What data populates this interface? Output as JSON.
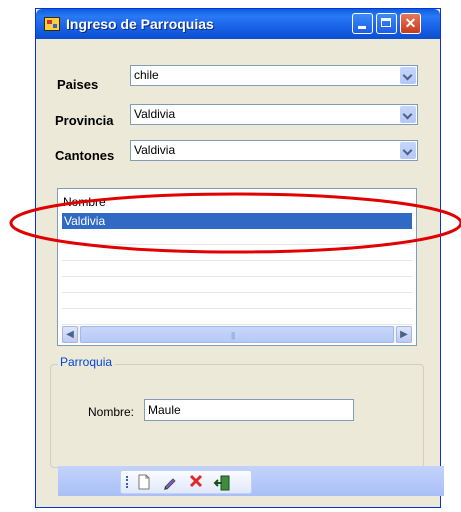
{
  "window": {
    "title": "Ingreso de Parroquias"
  },
  "fields": {
    "paises": {
      "label": "Paises",
      "value": "chile"
    },
    "provincia": {
      "label": "Provincia",
      "value": "Valdivia"
    },
    "cantones": {
      "label": "Cantones",
      "value": "Valdivia"
    }
  },
  "grid": {
    "header": "Nombre",
    "rows": [
      {
        "nombre": "Valdivia",
        "selected": true
      }
    ]
  },
  "group": {
    "title": "Parroquia",
    "nombre_label": "Nombre:",
    "nombre_value": "Maule"
  },
  "toolbar": {
    "icons": [
      "new-file-icon",
      "edit-pencil-icon",
      "delete-x-icon",
      "exit-door-icon"
    ]
  },
  "colors": {
    "selection": "#316ac5",
    "annotation": "#e00000",
    "titlebar": "#0a5fe0"
  }
}
